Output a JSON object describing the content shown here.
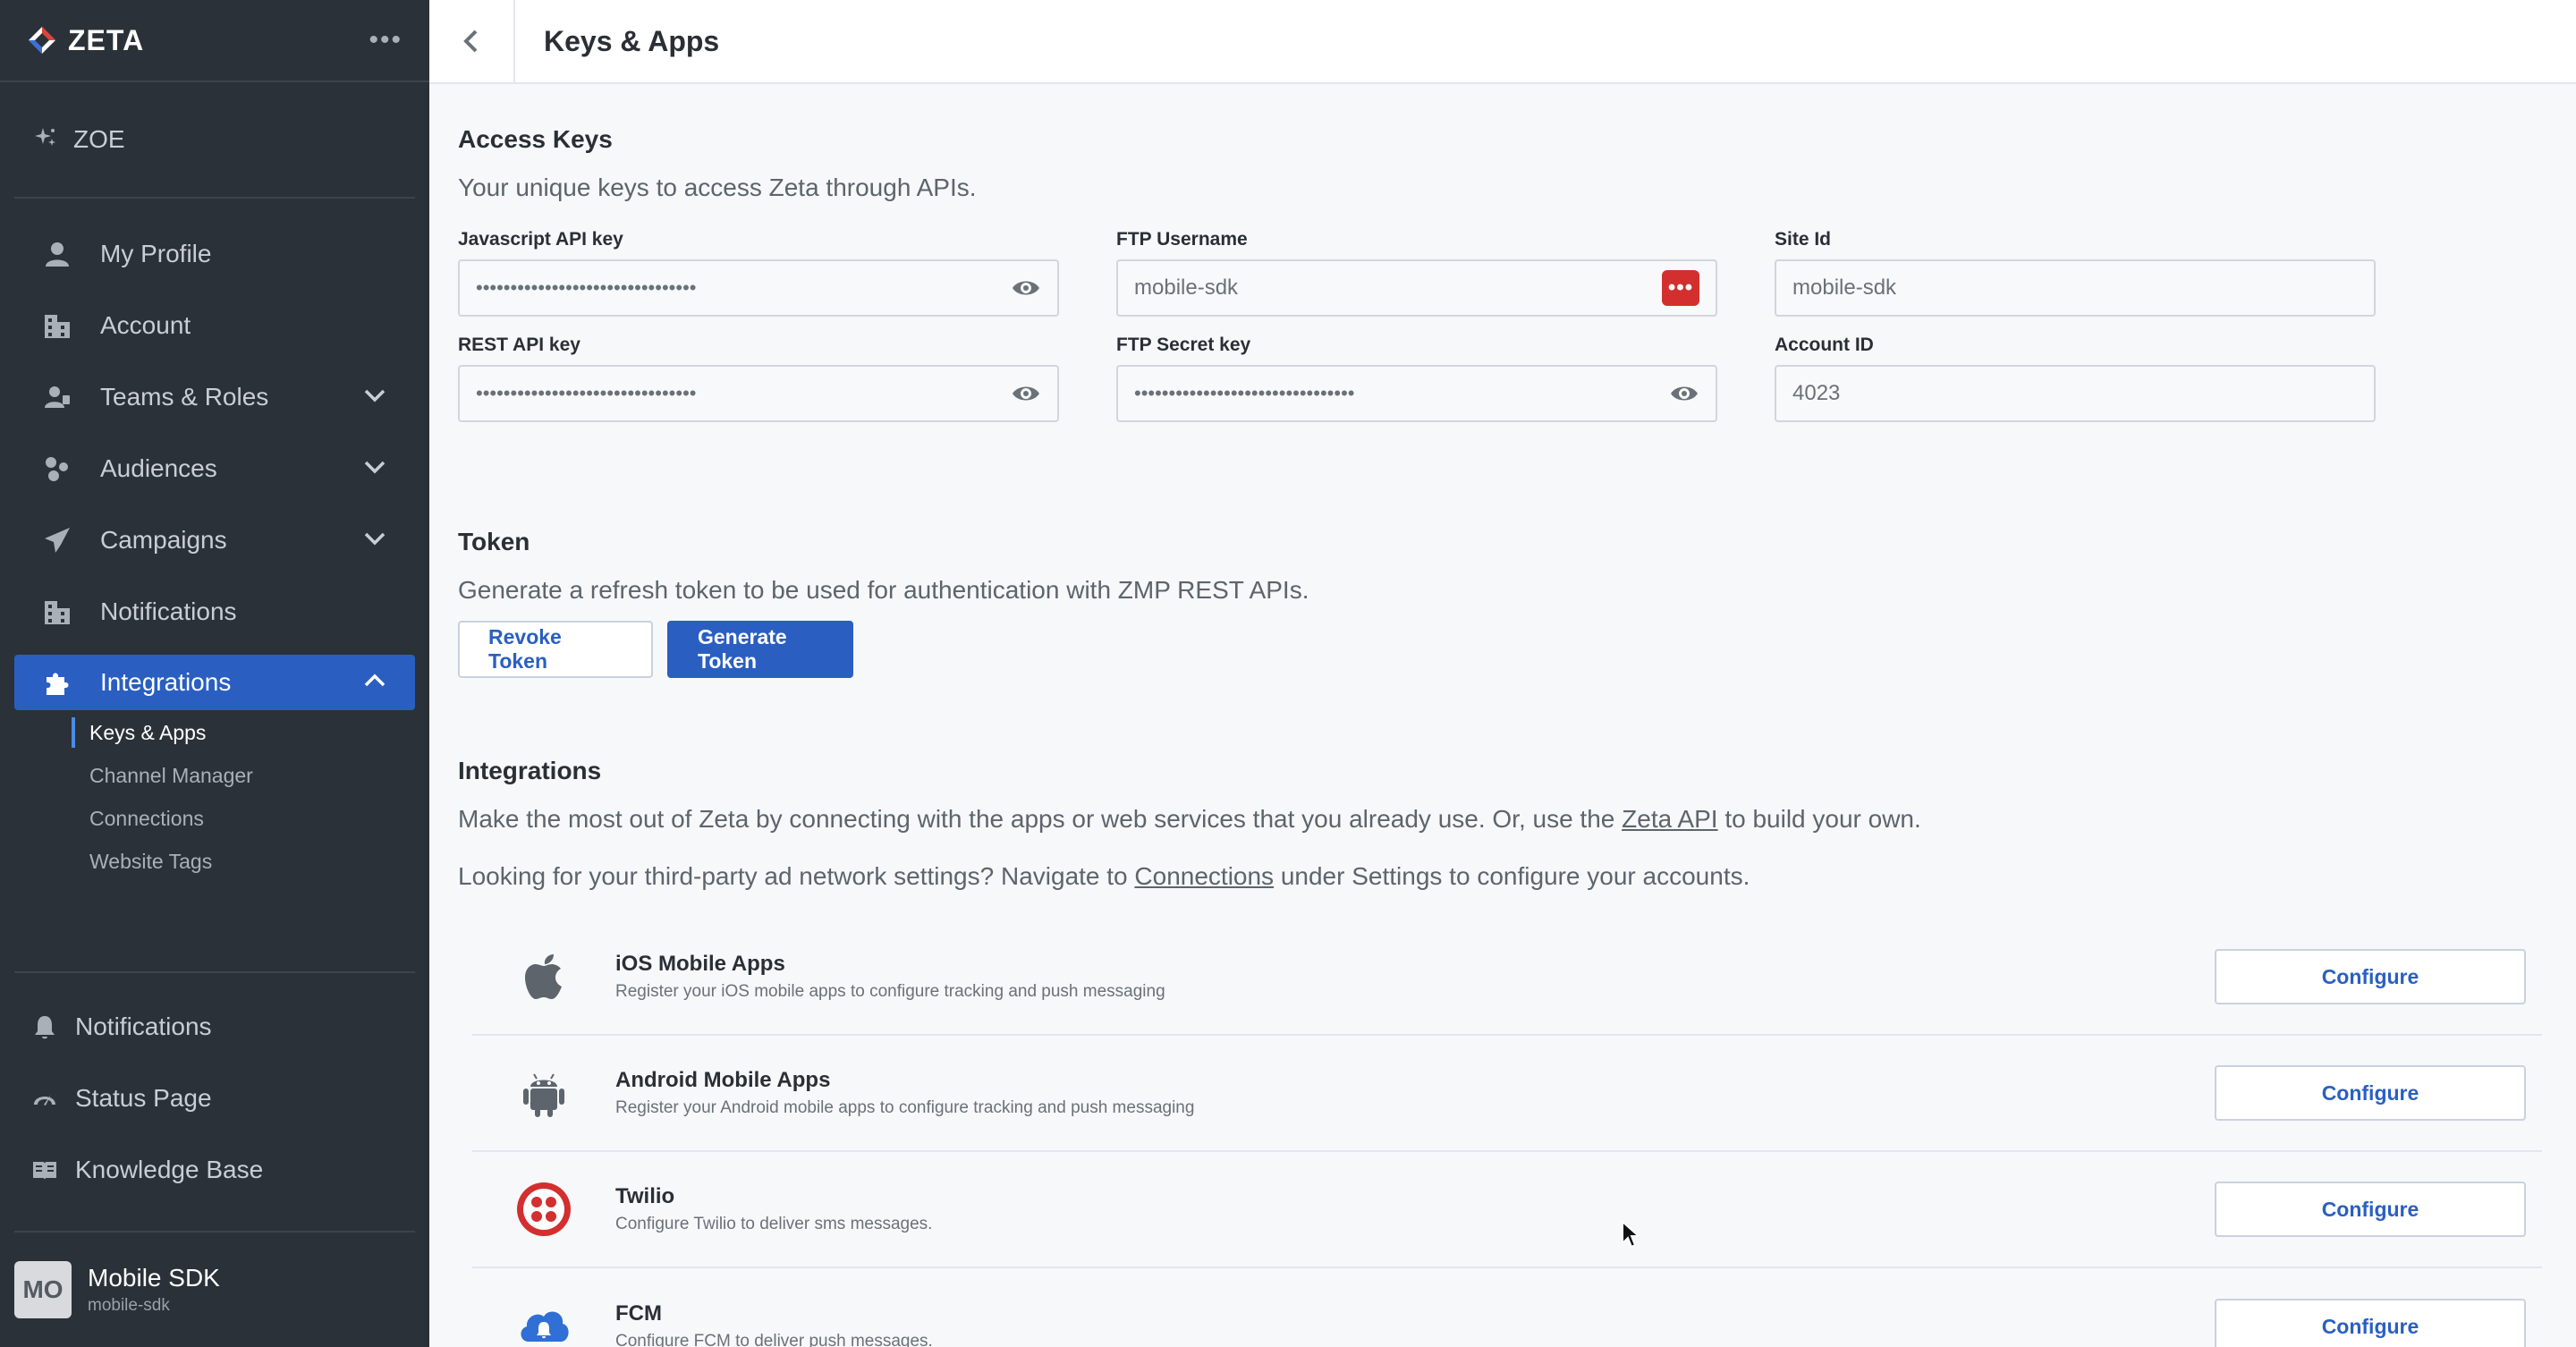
{
  "app": {
    "brand": "ZETA",
    "more": "•••",
    "zoe": "ZOE"
  },
  "sidebar": {
    "items": [
      {
        "label": "My Profile",
        "icon": "person-icon"
      },
      {
        "label": "Account",
        "icon": "building-icon"
      },
      {
        "label": "Teams & Roles",
        "icon": "team-icon",
        "expandable": true
      },
      {
        "label": "Audiences",
        "icon": "audiences-icon",
        "expandable": true
      },
      {
        "label": "Campaigns",
        "icon": "paper-plane-icon",
        "expandable": true
      },
      {
        "label": "Notifications",
        "icon": "building-icon"
      },
      {
        "label": "Integrations",
        "icon": "puzzle-icon",
        "expandable": true,
        "active": true
      }
    ],
    "subitems": [
      {
        "label": "Keys & Apps",
        "active": true
      },
      {
        "label": "Channel Manager"
      },
      {
        "label": "Connections"
      },
      {
        "label": "Website Tags"
      }
    ],
    "bottom": [
      {
        "label": "Notifications",
        "icon": "bell-icon"
      },
      {
        "label": "Status Page",
        "icon": "speedometer-icon"
      },
      {
        "label": "Knowledge Base",
        "icon": "book-icon"
      }
    ],
    "user": {
      "initials": "MO",
      "name": "Mobile SDK",
      "sub": "mobile-sdk"
    }
  },
  "header": {
    "title": "Keys & Apps"
  },
  "access_keys": {
    "title": "Access Keys",
    "desc": "Your unique keys to access Zeta through APIs.",
    "fields": {
      "js_key": {
        "label": "Javascript API key",
        "value": "••••••••••••••••••••••••••••••••"
      },
      "ftp_user": {
        "label": "FTP Username",
        "value": "mobile-sdk"
      },
      "site_id": {
        "label": "Site Id",
        "value": "mobile-sdk"
      },
      "rest_key": {
        "label": "REST API key",
        "value": "••••••••••••••••••••••••••••••••"
      },
      "ftp_secret": {
        "label": "FTP Secret key",
        "value": "••••••••••••••••••••••••••••••••"
      },
      "account_id": {
        "label": "Account ID",
        "value": "4023"
      }
    },
    "password_badge": "•••"
  },
  "token": {
    "title": "Token",
    "desc": "Generate a refresh token to be used for authentication with ZMP REST APIs.",
    "revoke_label": "Revoke Token",
    "generate_label": "Generate Token"
  },
  "integrations": {
    "title": "Integrations",
    "desc_before": "Make the most out of Zeta by connecting with the apps or web services that you already use. Or, use the ",
    "desc_link": "Zeta API",
    "desc_after": " to build your own.",
    "desc2_before": "Looking for your third-party ad network settings? Navigate to ",
    "desc2_link": "Connections",
    "desc2_after": " under Settings to configure your accounts.",
    "configure_label": "Configure",
    "items": [
      {
        "name": "iOS Mobile Apps",
        "desc": "Register your iOS mobile apps to configure tracking and push messaging",
        "icon": "apple-icon"
      },
      {
        "name": "Android Mobile Apps",
        "desc": "Register your Android mobile apps to configure tracking and push messaging",
        "icon": "android-icon"
      },
      {
        "name": "Twilio",
        "desc": "Configure Twilio to deliver sms messages.",
        "icon": "twilio-icon"
      },
      {
        "name": "FCM",
        "desc": "Configure FCM to deliver push messages.",
        "icon": "fcm-cloud-icon"
      }
    ]
  },
  "colors": {
    "sidebar_bg": "#2b3138",
    "accent": "#2a5fc1",
    "twilio_red": "#d32f2f",
    "fcm_blue": "#2f6fd6"
  }
}
